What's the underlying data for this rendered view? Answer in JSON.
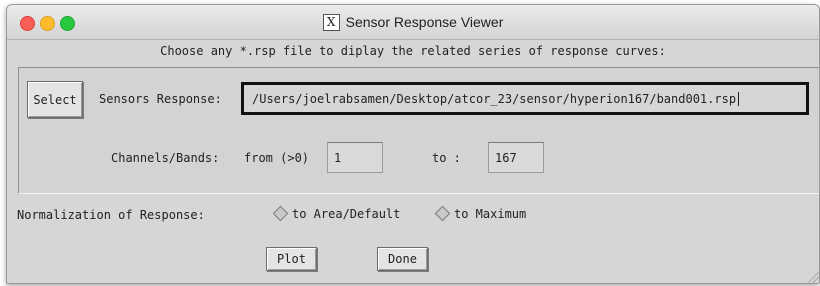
{
  "window": {
    "title": "Sensor Response Viewer",
    "x_icon": "X"
  },
  "instruction": "Choose any *.rsp file to diplay the related series of response curves:",
  "select_button": "Select",
  "sensors_response": {
    "label": "Sensors Response:",
    "value": "/Users/joelrabsamen/Desktop/atcor_23/sensor/hyperion167/band001.rsp"
  },
  "channels": {
    "label": "Channels/Bands:",
    "from_label": "from (>0)",
    "from_value": "1",
    "to_label": "to :",
    "to_value": "167"
  },
  "normalization": {
    "label": "Normalization of Response:",
    "option_area": "to Area/Default",
    "option_max": "to Maximum",
    "selected": "to Area/Default"
  },
  "actions": {
    "plot": "Plot",
    "done": "Done"
  },
  "colors": {
    "close": "#fc5f57",
    "minimize": "#fdbc2e",
    "maximize": "#28c840",
    "background": "#d6d6d6"
  }
}
